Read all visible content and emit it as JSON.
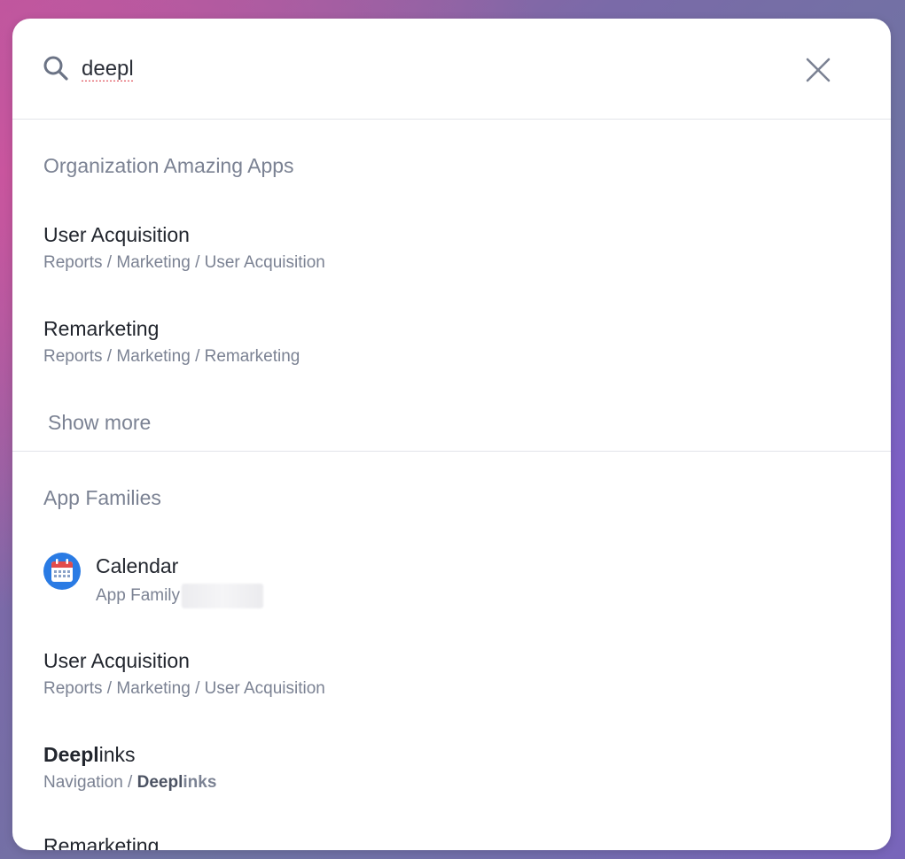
{
  "search": {
    "value": "deepl"
  },
  "sections": {
    "org": {
      "title": "Organization Amazing Apps",
      "items": [
        {
          "title": "User Acquisition",
          "path": "Reports / Marketing / User Acquisition"
        },
        {
          "title": "Remarketing",
          "path": "Reports / Marketing / Remarketing"
        }
      ],
      "show_more": "Show more"
    },
    "families": {
      "title": "App Families",
      "calendar": {
        "title": "Calendar",
        "subtitle": "App Family"
      },
      "items": [
        {
          "title": "User Acquisition",
          "path": "Reports / Marketing / User Acquisition"
        }
      ],
      "deeplinks": {
        "title_match": "Deepl",
        "title_rest": "inks",
        "path_prefix": "Navigation / ",
        "path_match": "Deepl",
        "path_rest": "inks"
      },
      "cut_item": "Remarketing"
    }
  },
  "colors": {
    "accent_blue": "#2a7be4",
    "calendar_red": "#e24c4b"
  },
  "icons": [
    "search-icon",
    "close-icon",
    "calendar-app-icon"
  ]
}
